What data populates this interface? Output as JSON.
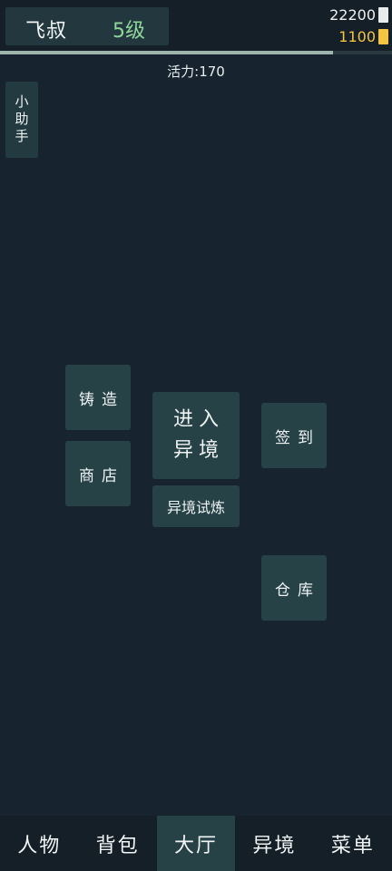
{
  "header": {
    "player_name": "飞叔",
    "player_level": "5级",
    "currency_primary": "22200",
    "currency_gold": "1100",
    "primary_icon_color": "#e9ecec",
    "gold_icon_color": "#f5c542",
    "progress_fraction": 0.85
  },
  "stamina_label": "活力:170",
  "helper_button_label": "小助手",
  "hall": {
    "forge_label": "铸造",
    "shop_label": "商店",
    "enter_label_line1": "进入",
    "enter_label_line2": "异境",
    "trial_label": "异境试炼",
    "checkin_label": "签到",
    "warehouse_label": "仓库"
  },
  "nav": {
    "items": [
      "人物",
      "背包",
      "大厅",
      "异境",
      "菜单"
    ],
    "active_index": 2
  },
  "colors": {
    "background": "#17242f",
    "tile": "#264247",
    "level_text": "#8fd69b",
    "gold_text": "#f5c542"
  }
}
